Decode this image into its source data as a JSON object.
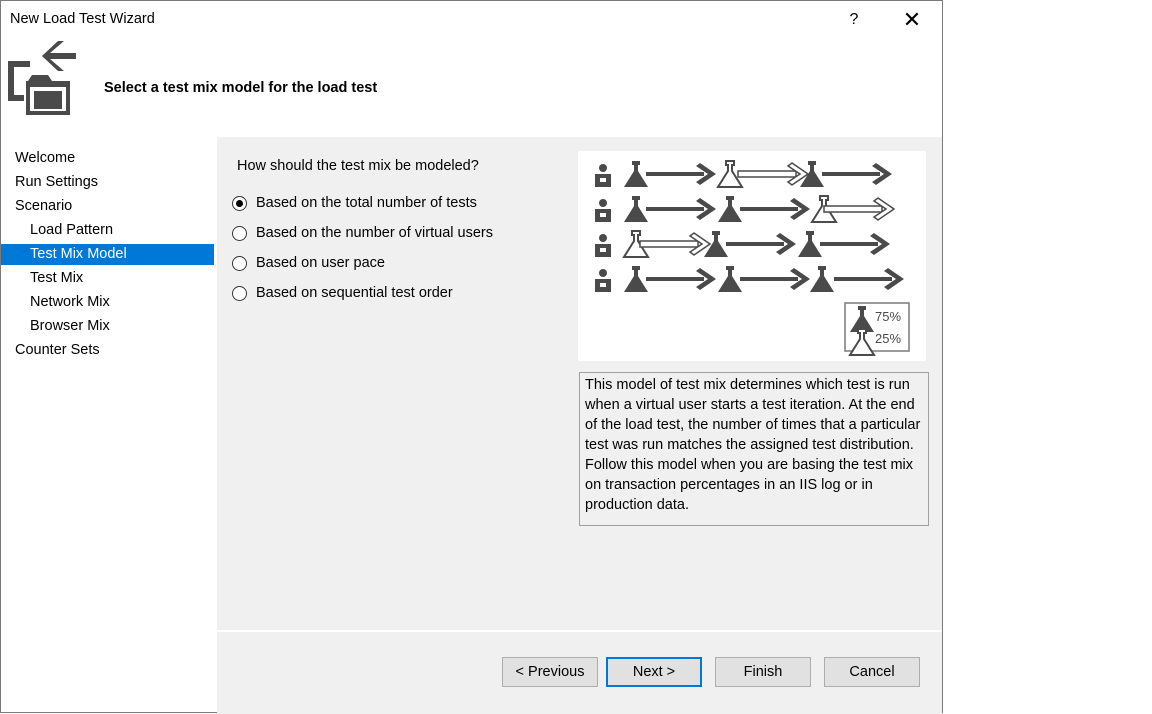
{
  "window": {
    "title": "New Load Test Wizard",
    "help_label": "?",
    "close_label": "✕"
  },
  "header": {
    "heading": "Select a test mix model for the load test",
    "icon": "wizard-folder-arrow-icon"
  },
  "nav": {
    "items": [
      {
        "label": "Welcome",
        "level": 1,
        "selected": false
      },
      {
        "label": "Run Settings",
        "level": 1,
        "selected": false
      },
      {
        "label": "Scenario",
        "level": 1,
        "selected": false
      },
      {
        "label": "Load Pattern",
        "level": 2,
        "selected": false
      },
      {
        "label": "Test Mix Model",
        "level": 2,
        "selected": true
      },
      {
        "label": "Test Mix",
        "level": 2,
        "selected": false
      },
      {
        "label": "Network Mix",
        "level": 2,
        "selected": false
      },
      {
        "label": "Browser Mix",
        "level": 2,
        "selected": false
      },
      {
        "label": "Counter Sets",
        "level": 1,
        "selected": false
      }
    ]
  },
  "main": {
    "question": "How should the test mix be modeled?",
    "options": [
      {
        "label": "Based on the total number of tests",
        "checked": true
      },
      {
        "label": "Based on the number of virtual users",
        "checked": false
      },
      {
        "label": "Based on user pace",
        "checked": false
      },
      {
        "label": "Based on sequential test order",
        "checked": false
      }
    ],
    "diagram_legend": {
      "dark_pct": "75%",
      "light_pct": "25%"
    },
    "description": "This model of test mix determines which test is run when a virtual user starts a test iteration. At the end of the load test, the number of times that a particular test was run matches the assigned test distribution. Follow this model when you are basing the test mix on transaction percentages in an IIS log or in production data."
  },
  "footer": {
    "previous_label": "< Previous",
    "next_label": "Next >",
    "finish_label": "Finish",
    "cancel_label": "Cancel"
  },
  "colors": {
    "selection": "#0078d7",
    "panel": "#f0f0f0",
    "icon_dark": "#4a4a4a"
  }
}
